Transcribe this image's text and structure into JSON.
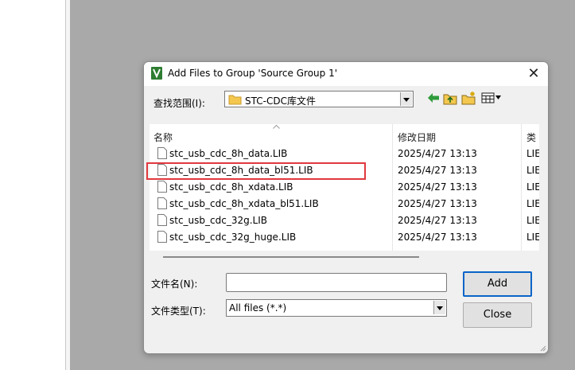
{
  "dialog": {
    "title": "Add Files to Group 'Source Group 1'",
    "close_glyph": "✕",
    "look_in": {
      "label": "查找范围(I):",
      "value": "STC-CDC库文件"
    },
    "toolbar": {
      "icons": [
        "back-arrow-icon",
        "up-folder-icon",
        "new-folder-icon",
        "view-menu-icon"
      ]
    },
    "columns": {
      "name": "名称",
      "date": "修改日期",
      "type": "类"
    },
    "files": [
      {
        "name": "stc_usb_cdc_8h_data.LIB",
        "date": "2025/4/27 13:13",
        "type": "LIE"
      },
      {
        "name": "stc_usb_cdc_8h_data_bl51.LIB",
        "date": "2025/4/27 13:13",
        "type": "LIE"
      },
      {
        "name": "stc_usb_cdc_8h_xdata.LIB",
        "date": "2025/4/27 13:13",
        "type": "LIE"
      },
      {
        "name": "stc_usb_cdc_8h_xdata_bl51.LIB",
        "date": "2025/4/27 13:13",
        "type": "LIE"
      },
      {
        "name": "stc_usb_cdc_32g.LIB",
        "date": "2025/4/27 13:13",
        "type": "LIE"
      },
      {
        "name": "stc_usb_cdc_32g_huge.LIB",
        "date": "2025/4/27 13:13",
        "type": "LIE"
      }
    ],
    "highlighted_file_index": 1,
    "highlight_color": "#e0393e",
    "file_name": {
      "label": "文件名(N):",
      "value": "",
      "placeholder": ""
    },
    "file_type": {
      "label": "文件类型(T):",
      "value": "All files (*.*)"
    },
    "buttons": {
      "add": "Add",
      "close": "Close"
    }
  }
}
